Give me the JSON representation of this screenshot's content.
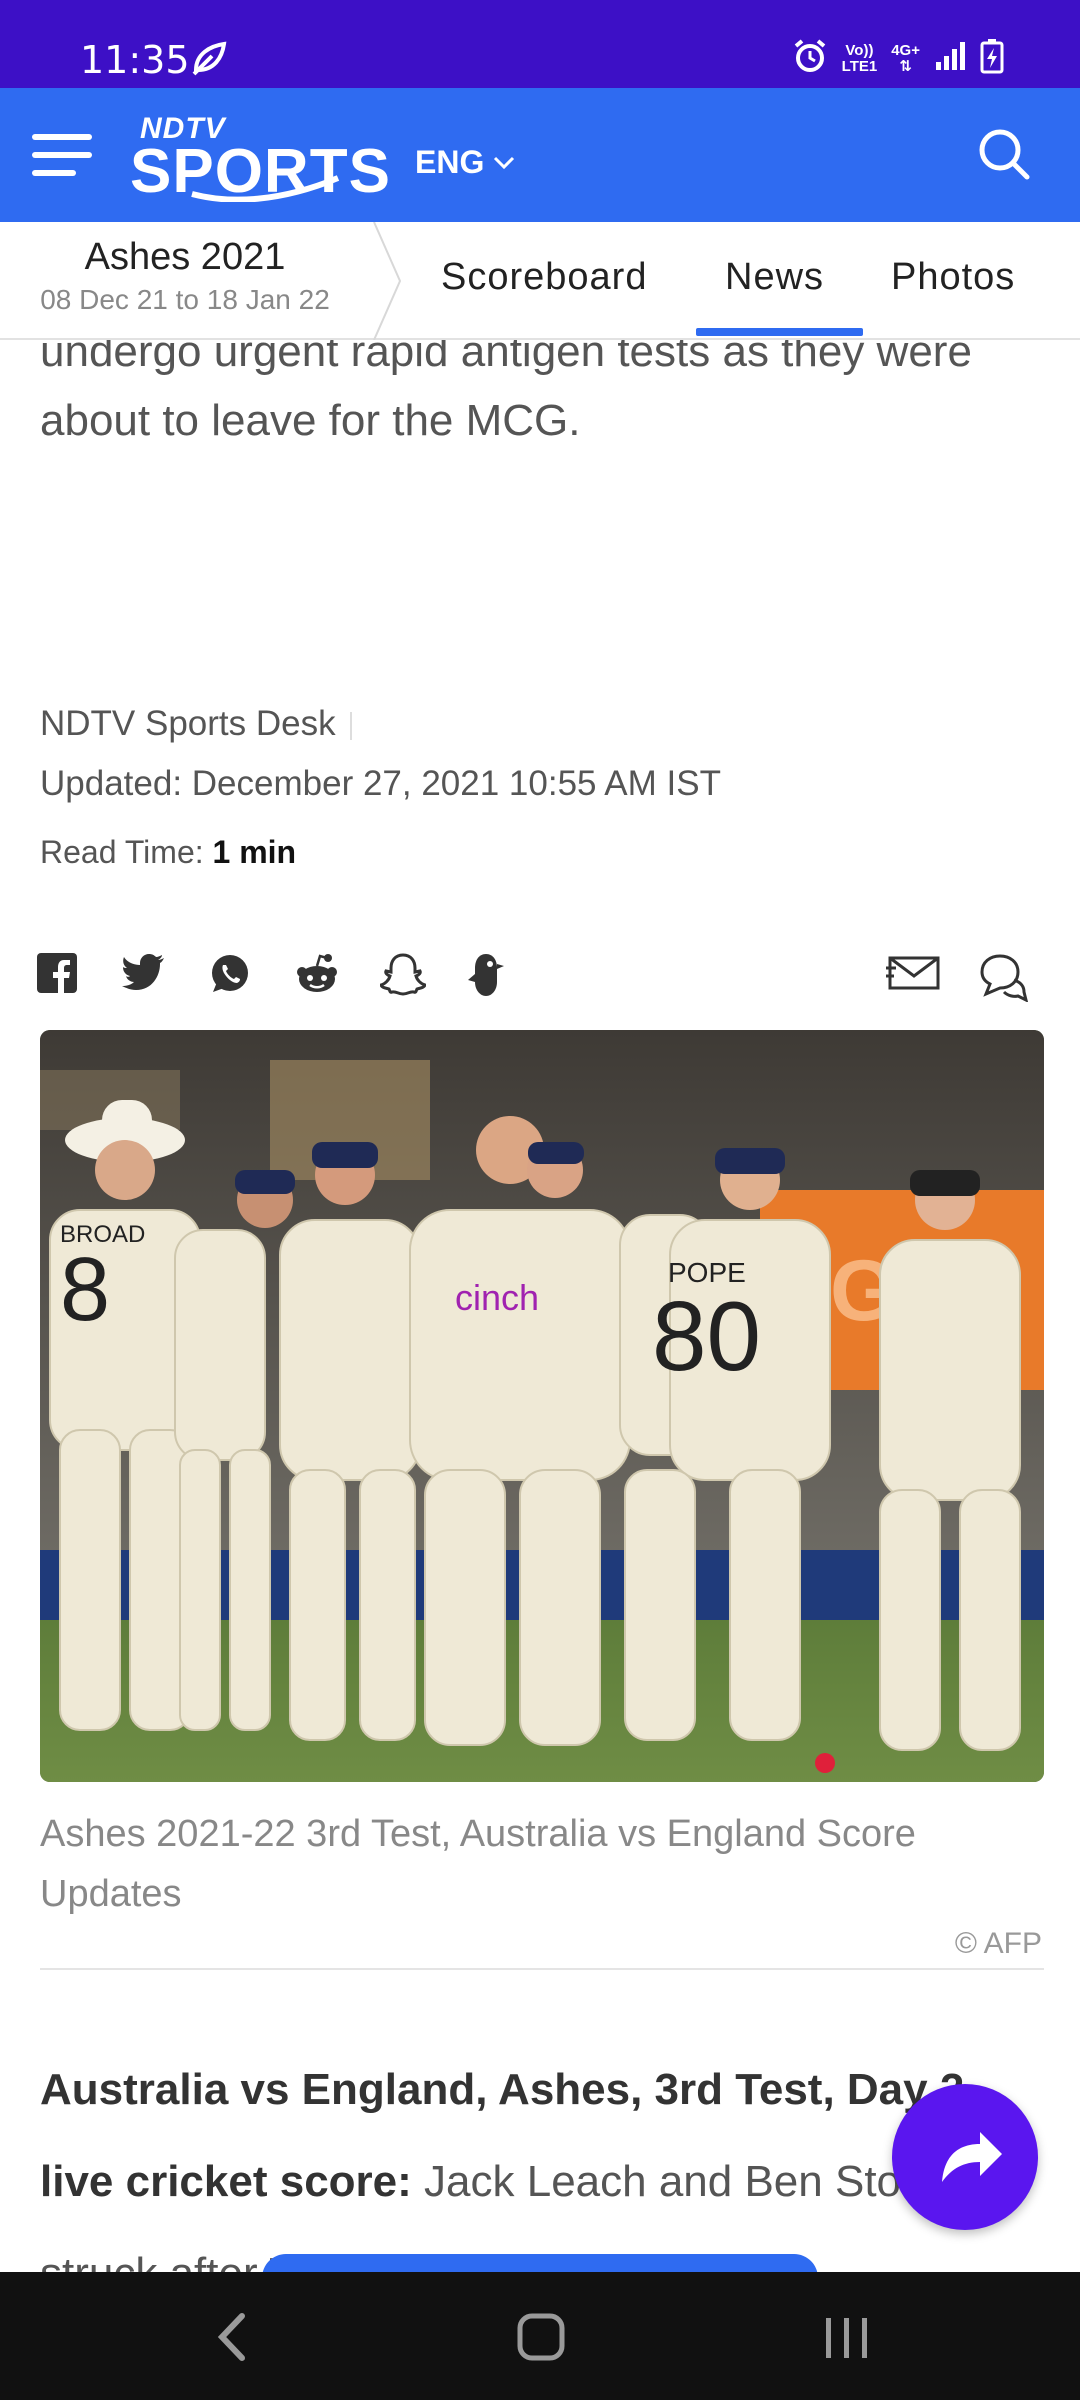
{
  "status_bar": {
    "time": "11:35",
    "volte_top": "Vo))",
    "volte_bottom": "LTE1",
    "network": "4G+"
  },
  "header": {
    "logo_top": "NDTV",
    "logo_main": "SPORTS",
    "language": "ENG"
  },
  "tabs": {
    "series_title": "Ashes 2021",
    "series_dates": "08 Dec 21 to 18 Jan 22",
    "items": [
      {
        "label": "Scoreboard"
      },
      {
        "label": "News",
        "active": true
      },
      {
        "label": "Photos"
      }
    ]
  },
  "article": {
    "lead_paragraph": "Score: Play began half an hour late after Covid drama in the England camp, with the team forced to undergo urgent rapid antigen tests as they were about to leave for the MCG.",
    "author": "NDTV Sports Desk",
    "updated": "Updated: December 27, 2021 10:55 AM IST",
    "read_time_label": "Read Time:",
    "read_time_value": "1 min",
    "share_icons": [
      "facebook-icon",
      "twitter-icon",
      "whatsapp-icon",
      "reddit-icon",
      "snapchat-icon",
      "koo-icon",
      "email-icon",
      "comment-icon"
    ],
    "image_caption": "Ashes 2021-22 3rd Test, Australia vs England Score Updates",
    "image_credit": "© AFP",
    "image_jersey_texts": {
      "broad": "BROAD",
      "broad_number": "8",
      "pope": "POPE",
      "pope_number": "80",
      "sponsor": "cinch",
      "board": "GAT"
    },
    "body_bold": "Australia vs England, Ashes, 3rd Test, Day 2, live cricket score:",
    "body_text": " Jack Leach and Ben Stokes struck after Team Australia lost"
  },
  "colors": {
    "status_bar": "#3d10c6",
    "header": "#2f6bf1",
    "fab": "#5a16ef",
    "tab_underline": "#2f6bf1"
  }
}
